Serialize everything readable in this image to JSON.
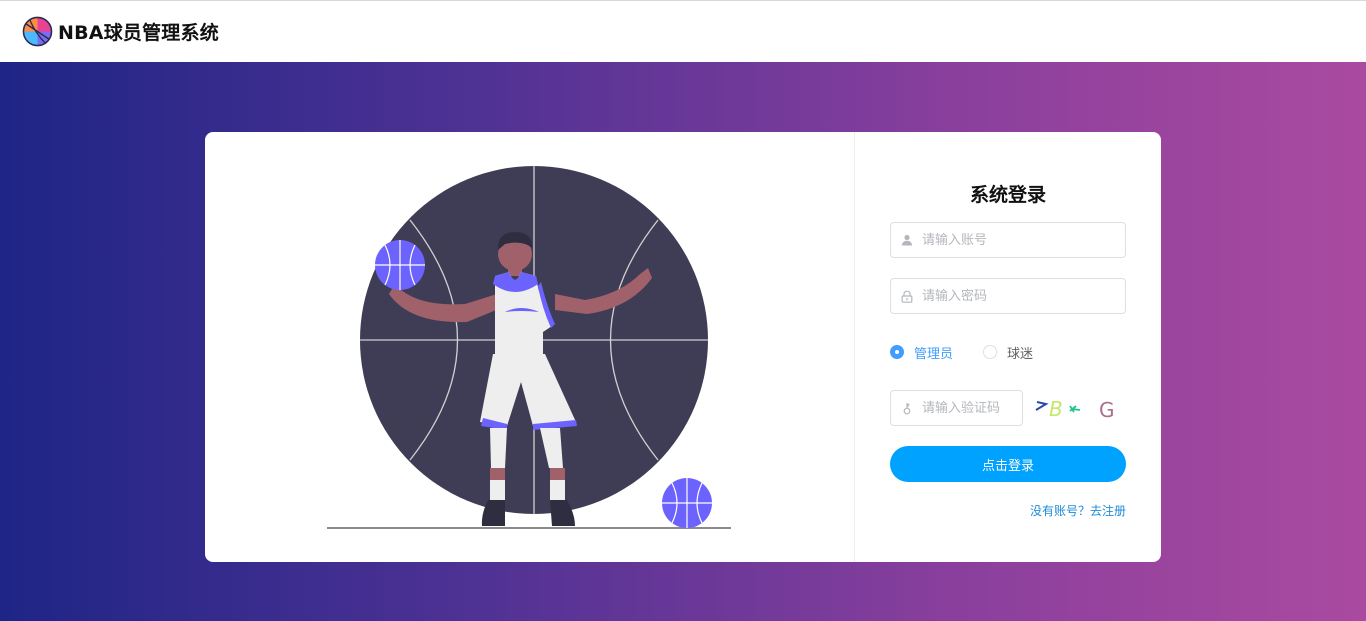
{
  "header": {
    "logo_icon": "basketball-icon",
    "title": "NBA球员管理系统"
  },
  "login": {
    "title": "系统登录",
    "username": {
      "placeholder": "请输入账号",
      "value": "",
      "icon": "user-icon"
    },
    "password": {
      "placeholder": "请输入密码",
      "value": "",
      "icon": "lock-icon"
    },
    "roles": [
      {
        "label": "管理员",
        "selected": true
      },
      {
        "label": "球迷",
        "selected": false
      }
    ],
    "captcha": {
      "placeholder": "请输入验证码",
      "value": "",
      "icon": "key-icon"
    },
    "submit_label": "点击登录",
    "register_link": "没有账号？去注册"
  },
  "colors": {
    "primary": "#00a2ff",
    "radio_active": "#409eff",
    "gradient_start": "#1e2586",
    "gradient_end": "#aa4aa0",
    "ball": "#6c63ff",
    "court_circle": "#3f3d56"
  }
}
